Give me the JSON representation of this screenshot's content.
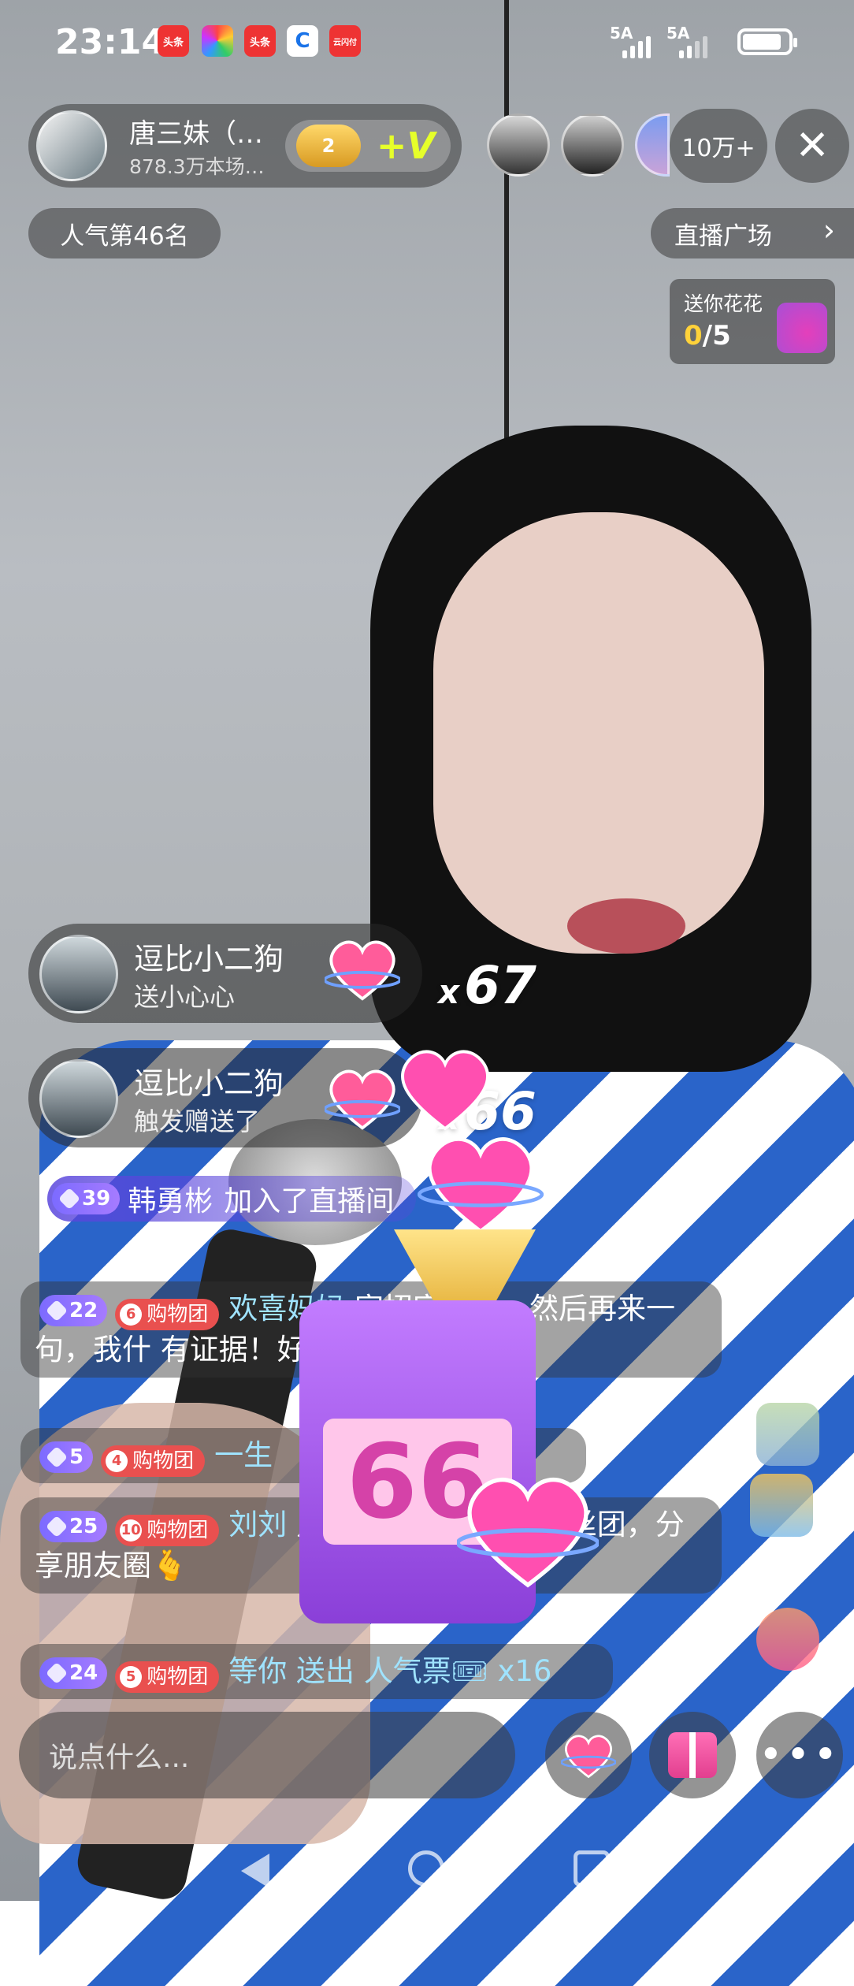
{
  "status_bar": {
    "time": "23:14",
    "app_icons": [
      {
        "name": "toutiao-icon",
        "label": "头条",
        "color": "#e33"
      },
      {
        "name": "photos-icon",
        "label": "",
        "color": "#fff"
      },
      {
        "name": "toutiao-icon",
        "label": "头条",
        "color": "#e33"
      },
      {
        "name": "app-c-icon",
        "label": "",
        "color": "#1a73e8"
      },
      {
        "name": "cloud-pay-icon",
        "label": "云闪付",
        "color": "#e33"
      }
    ],
    "signal_1": "5A",
    "signal_2": "5A"
  },
  "host": {
    "name": "唐三妹（…",
    "subtitle": "878.3万本场…",
    "fan_level": "2",
    "plus_v": "+V"
  },
  "viewer_count": "10万+",
  "rank": "人气第46名",
  "live_square": "直播广场",
  "flower": {
    "title": "送你花花",
    "current": "0",
    "total": "/5"
  },
  "gift_combos": [
    {
      "user": "逗比小二狗",
      "action": "送小心心",
      "count_prefix": "x",
      "count": "67"
    },
    {
      "user": "逗比小二狗",
      "action": "触发赠送了",
      "count_prefix": "x",
      "count": "66"
    }
  ],
  "join_notice": {
    "level": "39",
    "user": "韩勇彬",
    "action": "加入了直播间"
  },
  "chat": [
    {
      "level": "22",
      "fan_level": "6",
      "fan_label": "购物团",
      "user": "欢喜妈妈",
      "text": " 家招家网暴，然后再来一句，我什 有证据！好一句没有证据"
    },
    {
      "level": "5",
      "fan_level": "4",
      "fan_label": "购物团",
      "user": "一生",
      "text": ""
    },
    {
      "level": "25",
      "fan_level": "10",
      "fan_label": "购物团",
      "user": "刘刘",
      "text": " 点关注，点点赞，没 丝团，分享朋友圈🫰"
    },
    {
      "level": "24",
      "fan_level": "5",
      "fan_label": "购物团",
      "user": "等你",
      "text": " 送出 人气票🎟 x16"
    }
  ],
  "combo_display": "66",
  "input_placeholder": "说点什么...",
  "colors": {
    "accent_purple": "#7c6bff",
    "fan_red": "#e9504f",
    "gold": "#ffd23a",
    "username_blue": "#9fe3ff"
  }
}
